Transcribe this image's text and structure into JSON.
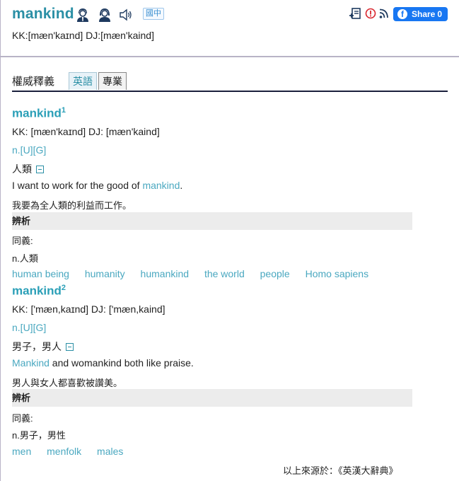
{
  "header": {
    "word": "mankind",
    "region_badge": "國中",
    "phonetic": "KK:[mæn'kaɪnd] DJ:[mæn'kaind]",
    "share": {
      "label": "Share",
      "count": "0"
    }
  },
  "tabs": {
    "heading": "權威釋義",
    "items": [
      {
        "label": "英語",
        "active": true
      },
      {
        "label": "專業",
        "active": false
      }
    ]
  },
  "entries": [
    {
      "word": "mankind",
      "sup": "1",
      "phonetic": "KK: [mæn'kaɪnd] DJ: [mæn'kaind]",
      "pos": "n.[U][G]",
      "sense": "人類",
      "example_en_before": "I want to work for the good of ",
      "example_en_highlight": "mankind",
      "example_en_after": ".",
      "example_zh": "我要為全人類的利益而工作。",
      "analysis_label": "辨析",
      "synonym_label": "同義:",
      "synonym_pos": "n.人類",
      "synonyms": [
        "human being",
        "humanity",
        "humankind",
        "the world",
        "people",
        "Homo sapiens"
      ]
    },
    {
      "word": "mankind",
      "sup": "2",
      "phonetic": "KK: ['mæn,kaɪnd] DJ: ['mæn,kaind]",
      "pos": "n.[U][G]",
      "sense": "男子，男人",
      "example_en_highlight": "Mankind",
      "example_en_after": " and womankind both like praise.",
      "example_zh": "男人與女人都喜歡被讚美。",
      "analysis_label": "辨析",
      "synonym_label": "同義:",
      "synonym_pos": "n.男子，男性",
      "synonyms": [
        "men",
        "menfolk",
        "males"
      ]
    }
  ],
  "source": "以上來源於：《英漢大辭典》",
  "colors": {
    "accent": "#2a9fb7",
    "link": "#4aa8c0",
    "facebook": "#1877f2",
    "warning": "#d9262e"
  }
}
